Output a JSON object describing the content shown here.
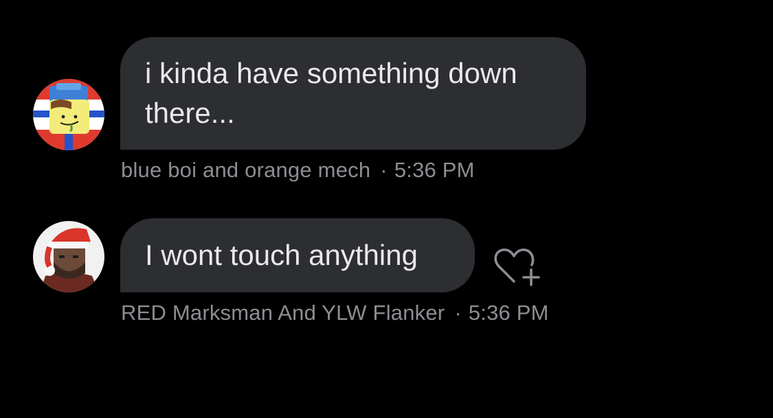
{
  "messages": [
    {
      "text": "i kinda have something down there...",
      "sender": "blue boi and orange mech",
      "separator": "·",
      "time": "5:36 PM"
    },
    {
      "text": "I wont touch anything",
      "sender": "RED Marksman And YLW Flanker",
      "separator": "·",
      "time": "5:36 PM"
    }
  ],
  "icons": {
    "reaction": "heart-plus-icon"
  },
  "colors": {
    "background": "#000000",
    "bubble": "#2d2e31",
    "bubble_text": "#e9e9eb",
    "meta_text": "#8d8e93"
  }
}
